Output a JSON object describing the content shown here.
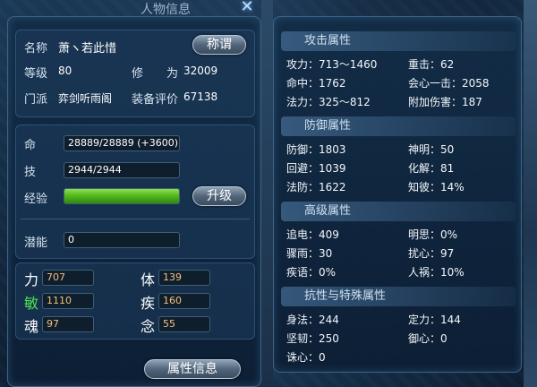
{
  "window": {
    "title": "人物信息"
  },
  "profile": {
    "name_label": "名称",
    "name_value": "萧ヽ若此惜",
    "title_button": "称谓",
    "level_label": "等级",
    "level_value": "80",
    "cultivation_label": "修　　为",
    "cultivation_value": "32009",
    "sect_label": "门派",
    "sect_value": "弈剑听雨阁",
    "gear_label": "装备评价",
    "gear_value": "67138"
  },
  "vitals": {
    "hp_label": "命",
    "hp_value": "28889/28889 (+3600)",
    "skill_label": "技",
    "skill_value": "2944/2944",
    "exp_label": "经验",
    "exp_fraction": 1.0,
    "upgrade_button": "升级",
    "potential_label": "潜能",
    "potential_value": "0"
  },
  "attributes": [
    {
      "label": "力",
      "value": "707",
      "color": "#ffffff"
    },
    {
      "label": "体",
      "value": "139",
      "color": "#ffffff"
    },
    {
      "label": "敏",
      "value": "1110",
      "color": "#4fe04f"
    },
    {
      "label": "疾",
      "value": "160",
      "color": "#ffffff"
    },
    {
      "label": "魂",
      "value": "97",
      "color": "#ffffff"
    },
    {
      "label": "念",
      "value": "55",
      "color": "#ffffff"
    }
  ],
  "footer": {
    "attr_info_button": "属性信息"
  },
  "right": {
    "groups": [
      {
        "title": "攻击属性",
        "rows": [
          [
            "攻力：713～1460",
            "重击：62"
          ],
          [
            "命中：1762",
            "会心一击：2058"
          ],
          [
            "法力：325～812",
            "附加伤害：187"
          ]
        ]
      },
      {
        "title": "防御属性",
        "rows": [
          [
            "防御：1803",
            "神明：50"
          ],
          [
            "回避：1039",
            "化解：81"
          ],
          [
            "法防：1622",
            "知彼：14%"
          ]
        ]
      },
      {
        "title": "高级属性",
        "rows": [
          [
            "追电：409",
            "明思：0%"
          ],
          [
            "骤雨：30",
            "扰心：97"
          ],
          [
            "疾语：0%",
            "人祸：10%"
          ]
        ]
      },
      {
        "title": "抗性与特殊属性",
        "rows": [
          [
            "身法：244",
            "定力：144"
          ],
          [
            "坚韧：250",
            "御心：0"
          ],
          [
            "诛心：0",
            ""
          ]
        ]
      }
    ]
  },
  "colors": {
    "accent_green": "#4fb61c",
    "stat_orange": "#f3c07a"
  }
}
